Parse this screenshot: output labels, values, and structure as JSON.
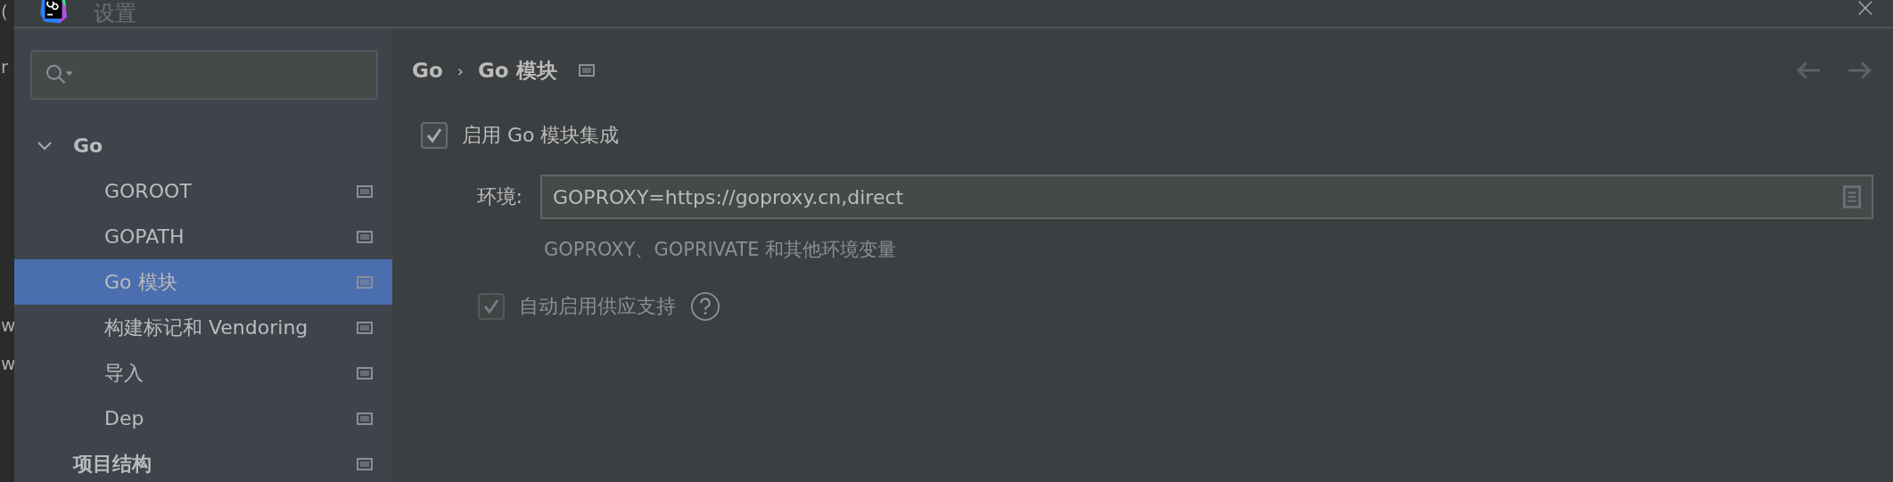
{
  "background_window": {
    "fragments": [
      "(",
      "r",
      "w",
      "w"
    ]
  },
  "window": {
    "title": "设置"
  },
  "sidebar": {
    "items": [
      {
        "label": "Go",
        "expanded": true,
        "selected": false,
        "children": [
          {
            "label": "GOROOT",
            "selected": false
          },
          {
            "label": "GOPATH",
            "selected": false
          },
          {
            "label": "Go 模块",
            "selected": true
          },
          {
            "label": "构建标记和 Vendoring",
            "selected": false
          },
          {
            "label": "导入",
            "selected": false
          },
          {
            "label": "Dep",
            "selected": false
          }
        ]
      },
      {
        "label": "项目结构",
        "selected": false
      }
    ]
  },
  "breadcrumb": [
    "Go",
    "Go 模块"
  ],
  "breadcrumb_separator": "›",
  "settings": [
    {
      "kind": "checkbox",
      "label": "启用 Go 模块集成",
      "checked": true,
      "disabled": false
    },
    {
      "kind": "field",
      "label": "环境:",
      "value": "GOPROXY=https://goproxy.cn,direct",
      "hint": "GOPROXY、GOPRIVATE 和其他环境变量"
    },
    {
      "kind": "checkbox",
      "label": "自动启用供应支持",
      "checked": true,
      "disabled": true,
      "help": true
    }
  ]
}
